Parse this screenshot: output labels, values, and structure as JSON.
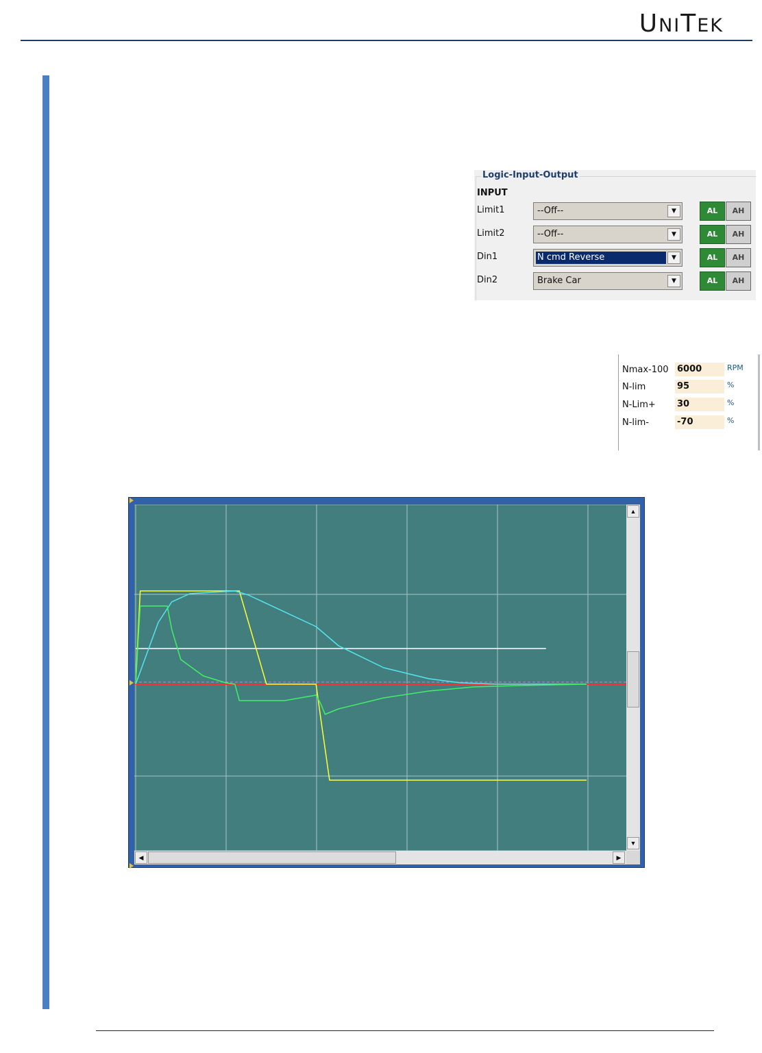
{
  "header": {
    "logo_first": "U",
    "logo_rest_a": "NI",
    "logo_mid": "T",
    "logo_rest_b": "EK"
  },
  "logic_io": {
    "legend": "Logic-Input-Output",
    "section_title": "INPUT",
    "rows": [
      {
        "label": "Limit1",
        "value": "--Off--",
        "selected": false,
        "al": "AL",
        "ah": "AH"
      },
      {
        "label": "Limit2",
        "value": "--Off--",
        "selected": false,
        "al": "AL",
        "ah": "AH"
      },
      {
        "label": "Din1",
        "value": "N cmd Reverse",
        "selected": true,
        "al": "AL",
        "ah": "AH"
      },
      {
        "label": "Din2",
        "value": "Brake Car",
        "selected": false,
        "al": "AL",
        "ah": "AH"
      }
    ],
    "dropdown_icon": "triangle-down-icon",
    "active_button_color": "#2f8a36"
  },
  "speed_limits": {
    "rows": [
      {
        "label": "Nmax-100",
        "value": "6000",
        "unit": "RPM"
      },
      {
        "label": "N-lim",
        "value": "95",
        "unit": "%"
      },
      {
        "label": "N-Lim+",
        "value": "30",
        "unit": "%"
      },
      {
        "label": "N-lim-",
        "value": "-70",
        "unit": "%"
      }
    ]
  },
  "chart_data": {
    "type": "line",
    "title": "",
    "xlabel": "",
    "ylabel": "",
    "xlim": [
      0,
      100
    ],
    "ylim": [
      -100,
      100
    ],
    "grid": true,
    "background": "#417e7d",
    "series": [
      {
        "color": "#ffff33",
        "x": [
          0,
          1,
          22,
          23,
          29,
          40,
          41,
          43,
          100
        ],
        "y": [
          0,
          68,
          68,
          68,
          0,
          0,
          -24,
          -70,
          -70
        ]
      },
      {
        "color": "#55e5ee",
        "x": [
          0,
          5,
          8,
          12,
          22,
          25,
          40,
          45,
          55,
          65,
          72,
          80,
          90,
          100
        ],
        "y": [
          0,
          45,
          60,
          66,
          68,
          65,
          42,
          28,
          12,
          4,
          1,
          0,
          0,
          0
        ]
      },
      {
        "color": "#44ee66",
        "x": [
          0,
          1,
          7,
          8,
          10,
          15,
          20,
          22,
          23,
          28,
          33,
          40,
          41,
          42,
          45,
          55,
          65,
          75,
          85,
          100
        ],
        "y": [
          0,
          57,
          57,
          40,
          18,
          6,
          1,
          0,
          -12,
          -12,
          -12,
          -8,
          -14,
          -22,
          -18,
          -10,
          -5,
          -2,
          -1,
          0
        ]
      },
      {
        "color": "#ff2e2e",
        "x": [
          0,
          100
        ],
        "y": [
          0,
          0
        ]
      },
      {
        "color": "#ffffff",
        "x": [
          0,
          91
        ],
        "y": [
          26,
          26
        ]
      }
    ]
  },
  "scope": {
    "up_icon": "arrow-up-icon",
    "down_icon": "arrow-down-icon",
    "left_icon": "arrow-left-icon",
    "right_icon": "arrow-right-icon"
  }
}
